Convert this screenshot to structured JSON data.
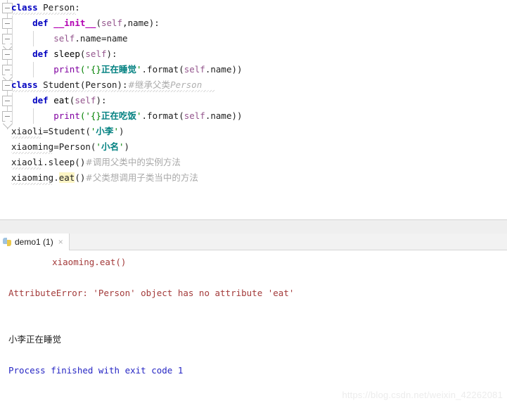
{
  "window": {
    "app": "PyCharm",
    "watermark": "https://blog.csdn.net/weixin_42262081"
  },
  "editor": {
    "language": "python",
    "lines": [
      {
        "n": 1,
        "indent": 0,
        "fold": "open",
        "tokens": [
          {
            "t": "class ",
            "c": "kw"
          },
          {
            "t": "Person:",
            "c": "plain"
          }
        ],
        "squiggle_width": 92
      },
      {
        "n": 2,
        "indent": 1,
        "fold": "open",
        "tokens": [
          {
            "t": "    ",
            "c": "plain"
          },
          {
            "t": "def ",
            "c": "kw"
          },
          {
            "t": "__init__",
            "c": "dunder"
          },
          {
            "t": "(",
            "c": "plain"
          },
          {
            "t": "self",
            "c": "selfp"
          },
          {
            "t": ",name):",
            "c": "plain"
          }
        ],
        "squiggle_width": 0
      },
      {
        "n": 3,
        "indent": 2,
        "fold": "end",
        "tokens": [
          {
            "t": "        ",
            "c": "plain"
          },
          {
            "t": "self",
            "c": "selfp"
          },
          {
            "t": ".name=name",
            "c": "plain"
          }
        ],
        "squiggle_width": 0
      },
      {
        "n": 4,
        "indent": 1,
        "fold": "open",
        "tokens": [
          {
            "t": "    ",
            "c": "plain"
          },
          {
            "t": "def ",
            "c": "kw"
          },
          {
            "t": "sleep",
            "c": "fnname"
          },
          {
            "t": "(",
            "c": "plain"
          },
          {
            "t": "self",
            "c": "selfp"
          },
          {
            "t": "):",
            "c": "plain"
          }
        ],
        "squiggle_width": 0
      },
      {
        "n": 5,
        "indent": 2,
        "fold": "end",
        "tokens": [
          {
            "t": "        ",
            "c": "plain"
          },
          {
            "t": "print",
            "c": "builtin"
          },
          {
            "t": "('{}",
            "c": "str"
          },
          {
            "t": "正在睡觉",
            "c": "strcn"
          },
          {
            "t": "'",
            "c": "str"
          },
          {
            "t": ".format(",
            "c": "plain"
          },
          {
            "t": "self",
            "c": "selfp"
          },
          {
            "t": ".name))",
            "c": "plain"
          }
        ],
        "squiggle_width": 0
      },
      {
        "n": 6,
        "indent": 0,
        "fold": "open",
        "tokens": [
          {
            "t": "class ",
            "c": "kw"
          },
          {
            "t": "Student(Person):",
            "c": "plain"
          },
          {
            "t": "#继承父类",
            "c": "cmt"
          },
          {
            "t": "Person",
            "c": "cmt-it"
          }
        ],
        "squiggle_width": 290
      },
      {
        "n": 7,
        "indent": 1,
        "fold": "open",
        "tokens": [
          {
            "t": "    ",
            "c": "plain"
          },
          {
            "t": "def ",
            "c": "kw"
          },
          {
            "t": "eat",
            "c": "fnname"
          },
          {
            "t": "(",
            "c": "plain"
          },
          {
            "t": "self",
            "c": "selfp"
          },
          {
            "t": "):",
            "c": "plain"
          }
        ],
        "squiggle_width": 0
      },
      {
        "n": 8,
        "indent": 2,
        "fold": "end",
        "tokens": [
          {
            "t": "        ",
            "c": "plain"
          },
          {
            "t": "print",
            "c": "builtin"
          },
          {
            "t": "('{}",
            "c": "str"
          },
          {
            "t": "正在吃饭",
            "c": "strcn"
          },
          {
            "t": "'",
            "c": "str"
          },
          {
            "t": ".format(",
            "c": "plain"
          },
          {
            "t": "self",
            "c": "selfp"
          },
          {
            "t": ".name))",
            "c": "plain"
          }
        ],
        "squiggle_width": 0
      },
      {
        "n": 9,
        "indent": 0,
        "fold": "none",
        "tokens": [
          {
            "t": "xiaoli=Student(",
            "c": "plain"
          },
          {
            "t": "'",
            "c": "str"
          },
          {
            "t": "小李",
            "c": "strcn"
          },
          {
            "t": "'",
            "c": "str"
          },
          {
            "t": ")",
            "c": "plain"
          }
        ],
        "squiggle_width": 42
      },
      {
        "n": 10,
        "indent": 0,
        "fold": "none",
        "tokens": [
          {
            "t": "xiaoming=Person(",
            "c": "plain"
          },
          {
            "t": "'",
            "c": "str"
          },
          {
            "t": "小名",
            "c": "strcn"
          },
          {
            "t": "'",
            "c": "str"
          },
          {
            "t": ")",
            "c": "plain"
          }
        ],
        "squiggle_width": 58
      },
      {
        "n": 11,
        "indent": 0,
        "fold": "none",
        "tokens": [
          {
            "t": "xiaoli.sleep()",
            "c": "plain"
          },
          {
            "t": "#调用父类中的实例方法",
            "c": "cmt"
          }
        ],
        "squiggle_width": 42
      },
      {
        "n": 12,
        "indent": 0,
        "fold": "none",
        "tokens": [
          {
            "t": "xiaoming.",
            "c": "plain"
          },
          {
            "t": "eat",
            "c": "plain hl"
          },
          {
            "t": "()",
            "c": "plain"
          },
          {
            "t": "#父类想调用子类当中的方法",
            "c": "cmt"
          }
        ],
        "squiggle_width": 58
      }
    ]
  },
  "run_tool_window": {
    "tab": {
      "label": "demo1 (1)",
      "icon": "python-file-icon",
      "close": "×"
    },
    "console_lines": [
      {
        "text": "    xiaoming.eat()",
        "style": "cerr cindent"
      },
      {
        "text": "",
        "style": "cerr"
      },
      {
        "text": "AttributeError: 'Person' object has no attribute 'eat'",
        "style": "cerr"
      },
      {
        "text": "",
        "style": "cout"
      },
      {
        "text": "",
        "style": "cout"
      },
      {
        "text": "小李正在睡觉",
        "style": "cout"
      },
      {
        "text": "",
        "style": "cout"
      },
      {
        "text": "Process finished with exit code 1",
        "style": "cblue"
      }
    ]
  },
  "colors": {
    "keyword": "#0000c0",
    "dunder": "#b200b2",
    "self": "#94558d",
    "builtin": "#8000a0",
    "string": "#008000",
    "string_cjk": "#008080",
    "comment": "#a9a9a9",
    "error": "#a33a3a",
    "exit_code": "#2727c4",
    "highlight_bg": "#fbf4c4",
    "editor_bg": "#ffffff",
    "splitter_bg": "#efefef",
    "tabbar_bg": "#f2f2f2"
  }
}
